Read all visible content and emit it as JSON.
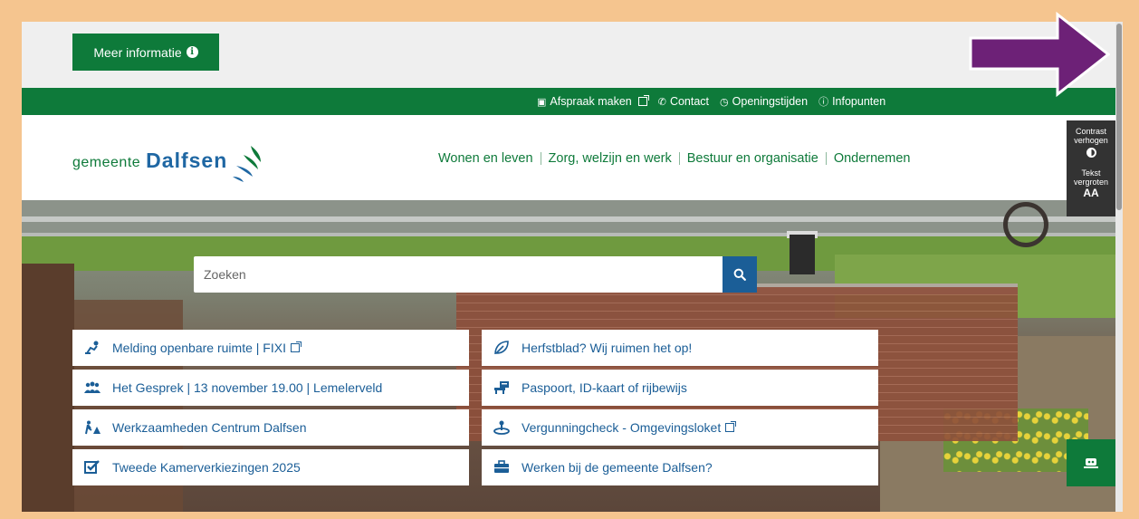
{
  "info_strip": {
    "button_label": "Meer informatie"
  },
  "util_bar": {
    "items": [
      {
        "label": "Afspraak maken",
        "icon": "calendar-icon",
        "external": true
      },
      {
        "label": "Contact",
        "icon": "phone-icon",
        "external": false
      },
      {
        "label": "Openingstijden",
        "icon": "clock-icon",
        "external": false
      },
      {
        "label": "Infopunten",
        "icon": "info-icon",
        "external": false
      }
    ]
  },
  "header": {
    "logo_small": "gemeente",
    "logo_big": "Dalfsen",
    "nav": [
      "Wonen en leven",
      "Zorg, welzijn en werk",
      "Bestuur en organisatie",
      "Ondernemen"
    ]
  },
  "search": {
    "placeholder": "Zoeken"
  },
  "quick_links": {
    "left": [
      {
        "label": "Melding openbare ruimte | FIXI",
        "icon": "person-worker-icon",
        "external": true
      },
      {
        "label": "Het Gesprek | 13 november 19.00 | Lemelerveld",
        "icon": "people-group-icon",
        "external": false
      },
      {
        "label": "Werkzaamheden Centrum Dalfsen",
        "icon": "roadwork-icon",
        "external": false
      },
      {
        "label": "Tweede Kamerverkiezingen 2025",
        "icon": "checkbox-vote-icon",
        "external": false
      }
    ],
    "right": [
      {
        "label": "Herfstblad? Wij ruimen het op!",
        "icon": "leaf-icon",
        "external": false
      },
      {
        "label": "Paspoort, ID-kaart of rijbewijs",
        "icon": "id-card-icon",
        "external": false
      },
      {
        "label": "Vergunningcheck - Omgevingsloket",
        "icon": "building-permit-icon",
        "external": true
      },
      {
        "label": "Werken bij de gemeente Dalfsen?",
        "icon": "briefcase-icon",
        "external": false
      }
    ]
  },
  "side_tools": {
    "contrast_line1": "Contrast",
    "contrast_line2": "verhogen",
    "text_line1": "Tekst",
    "text_line2": "vergroten",
    "text_icon": "AA"
  },
  "colors": {
    "brand_green": "#0e7a3a",
    "brand_blue": "#1b5e97",
    "frame": "#f5c58f",
    "arrow": "#6d2177"
  }
}
